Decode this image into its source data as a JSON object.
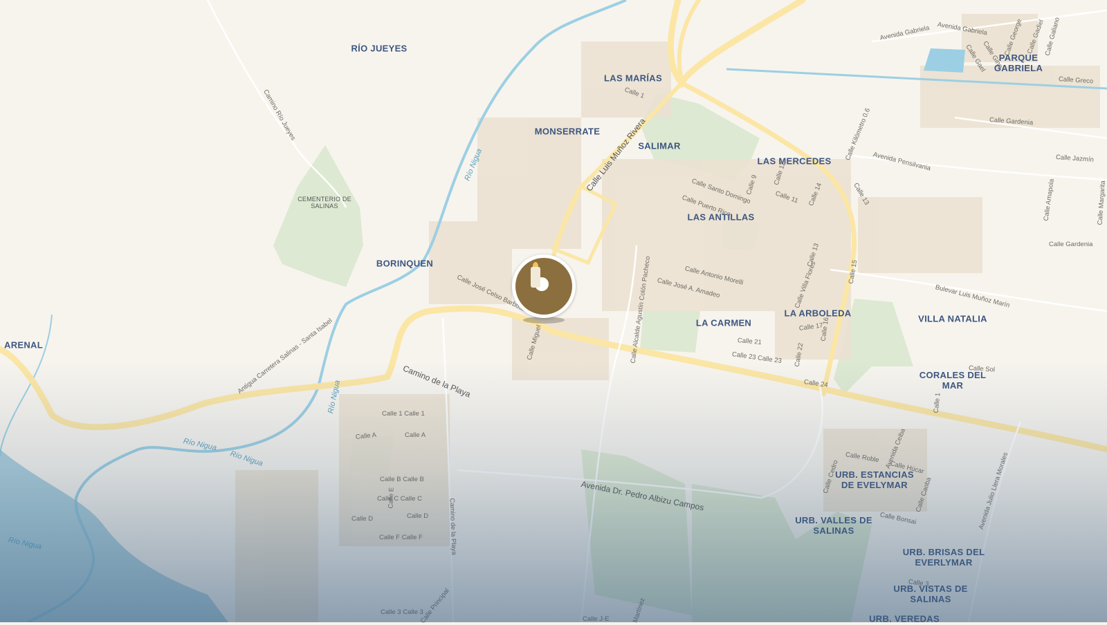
{
  "map": {
    "places": [
      {
        "id": "rio-jueyes",
        "text": "RÍO JUEYES"
      },
      {
        "id": "las-marias",
        "text": "LAS MARÍAS"
      },
      {
        "id": "parque-gabriela",
        "text": "PARQUE\nGABRIELA"
      },
      {
        "id": "monserrate",
        "text": "MONSERRATE"
      },
      {
        "id": "salimar",
        "text": "SALIMAR"
      },
      {
        "id": "las-mercedes",
        "text": "LAS MERCEDES"
      },
      {
        "id": "las-antillas",
        "text": "LAS ANTILLAS"
      },
      {
        "id": "cementerio",
        "text": "CEMENTERIO DE\nSALINAS"
      },
      {
        "id": "borinquen",
        "text": "BORINQUEN"
      },
      {
        "id": "arenal",
        "text": "ARENAL"
      },
      {
        "id": "la-carmen",
        "text": "LA CARMEN"
      },
      {
        "id": "la-arboleda",
        "text": "LA ARBOLEDA"
      },
      {
        "id": "villa-natalia",
        "text": "VILLA NATALIA"
      },
      {
        "id": "corales-del-mar",
        "text": "CORALES DEL\nMAR"
      },
      {
        "id": "urb-estancias",
        "text": "URB. ESTANCIAS\nDE EVELYMAR"
      },
      {
        "id": "urb-valles",
        "text": "URB. VALLES DE\nSALINAS"
      },
      {
        "id": "urb-brisas",
        "text": "URB. BRISAS DEL\nEVERLYMAR"
      },
      {
        "id": "urb-vistas",
        "text": "URB. VISTAS DE\nSALINAS"
      },
      {
        "id": "urb-veredas",
        "text": "URB. VEREDAS"
      }
    ],
    "streets": [
      {
        "id": "avenida-gabriela-1",
        "text": "Avenida Gabriela"
      },
      {
        "id": "avenida-gabriela-2",
        "text": "Avenida Gabriela"
      },
      {
        "id": "calle-george",
        "text": "Calle George"
      },
      {
        "id": "calle-gadiel",
        "text": "Calle Gadiel"
      },
      {
        "id": "calle-galiano",
        "text": "Calle Galiano"
      },
      {
        "id": "calle-gael",
        "text": "Calle Gael"
      },
      {
        "id": "calle-gino",
        "text": "Calle Gino"
      },
      {
        "id": "calle-greco",
        "text": "Calle Greco"
      },
      {
        "id": "calle-gardenia-1",
        "text": "Calle Gardenia"
      },
      {
        "id": "calle-gardenia-2",
        "text": "Calle Gardenia"
      },
      {
        "id": "calle-jazmin",
        "text": "Calle Jazmín"
      },
      {
        "id": "calle-kilometro",
        "text": "Calle Kilómetro 0.6"
      },
      {
        "id": "avenida-pensilvania",
        "text": "Avenida Pensilvania"
      },
      {
        "id": "calle-amapola",
        "text": "Calle Amapola"
      },
      {
        "id": "calle-margarita",
        "text": "Calle Margarita"
      },
      {
        "id": "calle-1-top",
        "text": "Calle 1"
      },
      {
        "id": "calle-luis-munoz-rivera",
        "text": "Calle Luis Muñoz Rivera"
      },
      {
        "id": "calle-santo-domingo",
        "text": "Calle Santo Domingo"
      },
      {
        "id": "calle-puerto-rico",
        "text": "Calle Puerto Rico"
      },
      {
        "id": "calle-9",
        "text": "Calle 9"
      },
      {
        "id": "calle-12",
        "text": "Calle 12"
      },
      {
        "id": "calle-11",
        "text": "Calle 11"
      },
      {
        "id": "calle-14",
        "text": "Calle 14"
      },
      {
        "id": "calle-13",
        "text": "Calle 13"
      },
      {
        "id": "calle-15",
        "text": "Calle 15"
      },
      {
        "id": "calle-antonio-morelli",
        "text": "Calle Antonio Morelli"
      },
      {
        "id": "calle-jose-a-amadeo",
        "text": "Calle José A. Amadeo"
      },
      {
        "id": "calle-villa-flores",
        "text": "Calle Villa Flores"
      },
      {
        "id": "calle-13b",
        "text": "Calle 13"
      },
      {
        "id": "bulevar-luis-munoz-marin",
        "text": "Bulevar Luis Muñoz Marín"
      },
      {
        "id": "calle-17",
        "text": "Calle 17"
      },
      {
        "id": "calle-16",
        "text": "Calle 16"
      },
      {
        "id": "calle-21",
        "text": "Calle 21"
      },
      {
        "id": "calle-22",
        "text": "Calle 22"
      },
      {
        "id": "calle-23",
        "text": "Calle 23 Calle 23"
      },
      {
        "id": "calle-24",
        "text": "Calle 24"
      },
      {
        "id": "calle-sol",
        "text": "Calle Sol"
      },
      {
        "id": "calle-alcalde",
        "text": "Calle Alcalde Agustín Colón Pacheco"
      },
      {
        "id": "calle-jose-celso-barbosa",
        "text": "Calle José Celso Barbosa"
      },
      {
        "id": "calle-miguel",
        "text": "Calle Miguel"
      },
      {
        "id": "camino-rio-jueyes",
        "text": "Camino Río Jueyes"
      },
      {
        "id": "antigua-carretera",
        "text": "Antigua Carretera Salinas - Santa Isabel"
      },
      {
        "id": "camino-de-la-playa-1",
        "text": "Camino de la Playa"
      },
      {
        "id": "camino-de-la-playa-2",
        "text": "Camino de la Playa"
      },
      {
        "id": "calle-1-bottom",
        "text": "Calle 1 Calle 1"
      },
      {
        "id": "calle-a-1",
        "text": "Calle A"
      },
      {
        "id": "calle-a-2",
        "text": "Calle A"
      },
      {
        "id": "calle-b",
        "text": "Calle B Calle B"
      },
      {
        "id": "calle-c",
        "text": "Calle C   Calle C"
      },
      {
        "id": "calle-d-1",
        "text": "Calle D"
      },
      {
        "id": "calle-d-2",
        "text": "Calle D"
      },
      {
        "id": "calle-e",
        "text": "Calle E"
      },
      {
        "id": "calle-f",
        "text": "Calle F Calle F"
      },
      {
        "id": "calle-3",
        "text": "Calle 3 Calle 3"
      },
      {
        "id": "calle-principal",
        "text": "Calle Principal"
      },
      {
        "id": "calle-j-e",
        "text": "Calle J-E"
      },
      {
        "id": "calle-martinez",
        "text": "Martínez"
      },
      {
        "id": "avenida-albizu",
        "text": "Avenida Dr. Pedro Albizu Campos"
      },
      {
        "id": "calle-roble",
        "text": "Calle Roble"
      },
      {
        "id": "avenida-ceiba",
        "text": "Avenida Ceiba"
      },
      {
        "id": "calle-hucar",
        "text": "Calle Húcar"
      },
      {
        "id": "calle-cedro",
        "text": "Calle Cedro"
      },
      {
        "id": "calle-caoba",
        "text": "Calle Caoba"
      },
      {
        "id": "calle-bonsai",
        "text": "Calle Bonsai"
      },
      {
        "id": "avenida-julio-llera",
        "text": "Avenida Julio Llera Morales"
      },
      {
        "id": "calle-1-right",
        "text": "Calle 1"
      },
      {
        "id": "calle-3-right",
        "text": "Calle 3"
      }
    ],
    "rivers": [
      {
        "id": "rio-nigua-1",
        "text": "Río Nigua"
      },
      {
        "id": "rio-nigua-2",
        "text": "Río Nigua"
      },
      {
        "id": "rio-nigua-3",
        "text": "Río Nigua"
      },
      {
        "id": "rio-nigua-4",
        "text": "Río Nigua"
      },
      {
        "id": "rio-nigua-5",
        "text": "Río Nigua"
      }
    ],
    "marker": {
      "icon": "candle-icon",
      "accent": "#8b6f3e"
    },
    "colors": {
      "land": "#f7f4ee",
      "park": "#dde9d2",
      "road_major": "#fbe6a5",
      "water": "#9ccfe3",
      "blocks": "#ece4d6"
    }
  }
}
